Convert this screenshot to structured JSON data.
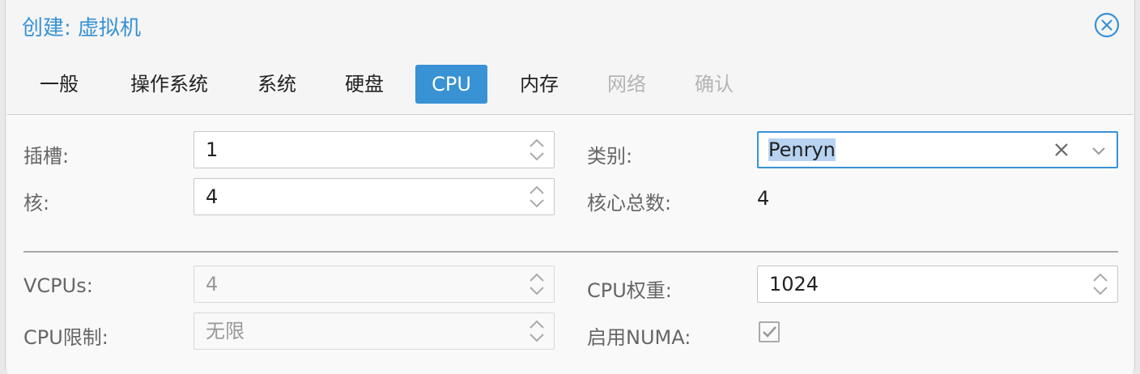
{
  "dialog": {
    "title": "创建: 虚拟机"
  },
  "tabs": [
    {
      "label": "一般",
      "state": "normal"
    },
    {
      "label": "操作系统",
      "state": "normal"
    },
    {
      "label": "系统",
      "state": "normal"
    },
    {
      "label": "硬盘",
      "state": "normal"
    },
    {
      "label": "CPU",
      "state": "active"
    },
    {
      "label": "内存",
      "state": "normal"
    },
    {
      "label": "网络",
      "state": "disabled"
    },
    {
      "label": "确认",
      "state": "disabled"
    }
  ],
  "form": {
    "sockets": {
      "label": "插槽:",
      "value": "1"
    },
    "cores": {
      "label": "核:",
      "value": "4"
    },
    "type": {
      "label": "类别:",
      "value": "Penryn"
    },
    "total_cores": {
      "label": "核心总数:",
      "value": "4"
    },
    "vcpus": {
      "label": "VCPUs:",
      "value": "4",
      "disabled": true
    },
    "cpu_limit": {
      "label": "CPU限制:",
      "value": "无限",
      "disabled": true
    },
    "cpu_units": {
      "label": "CPU权重:",
      "value": "1024"
    },
    "numa": {
      "label": "启用NUMA:",
      "checked": true,
      "disabled": true
    }
  },
  "colors": {
    "accent": "#3892d4",
    "disabled_text": "#b5b5b5"
  }
}
